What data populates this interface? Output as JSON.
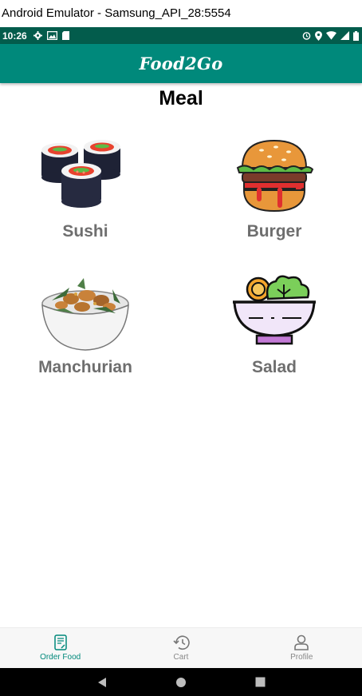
{
  "window": {
    "title": "Android Emulator - Samsung_API_28:5554"
  },
  "status_bar": {
    "time": "10:26"
  },
  "app_bar": {
    "title": "Food2Go"
  },
  "section": {
    "title": "Meal"
  },
  "meals": [
    {
      "label": "Sushi",
      "icon": "sushi-icon"
    },
    {
      "label": "Burger",
      "icon": "burger-icon"
    },
    {
      "label": "Manchurian",
      "icon": "manchurian-icon"
    },
    {
      "label": "Salad",
      "icon": "salad-icon"
    }
  ],
  "bottom_nav": {
    "items": [
      {
        "label": "Order Food",
        "icon": "order-food-icon",
        "active": true
      },
      {
        "label": "Cart",
        "icon": "history-icon",
        "active": false
      },
      {
        "label": "Profile",
        "icon": "person-icon",
        "active": false
      }
    ]
  },
  "colors": {
    "status_bar": "#035c4c",
    "app_bar": "#00897b",
    "active_nav": "#00897b",
    "meal_label": "#6e6e6e"
  }
}
